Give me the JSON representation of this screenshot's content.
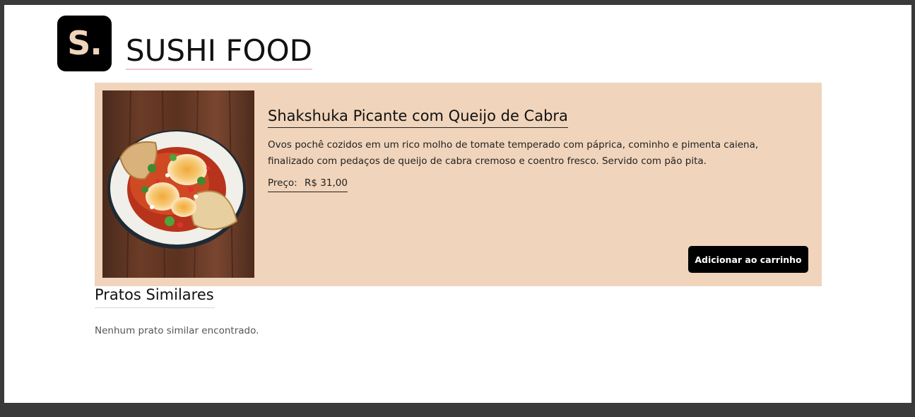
{
  "header": {
    "logo_text": "S.",
    "brand_name": "SUSHI FOOD"
  },
  "dish": {
    "title": "Shakshuka Picante com Queijo de Cabra",
    "description": "Ovos pochê cozidos em um rico molho de tomate temperado com páprica, cominho e pimenta caiena, finalizado com pedaços de queijo de cabra cremoso e coentro fresco. Servido com pão pita.",
    "price_label": "Preço:",
    "price_value": "R$ 31,00",
    "add_to_cart_label": "Adicionar ao carrinho",
    "image_alt": "shakshuka-dish-photo"
  },
  "similar": {
    "title": "Pratos Similares",
    "empty_message": "Nenhum prato similar encontrado."
  },
  "colors": {
    "page_frame": "#3a3a3a",
    "card_background": "#f0d4bb",
    "logo_background": "#000000",
    "logo_letter": "#f0d4bb",
    "brand_underline": "#f3c2d4",
    "button_background": "#000000",
    "button_text": "#ffffff"
  }
}
